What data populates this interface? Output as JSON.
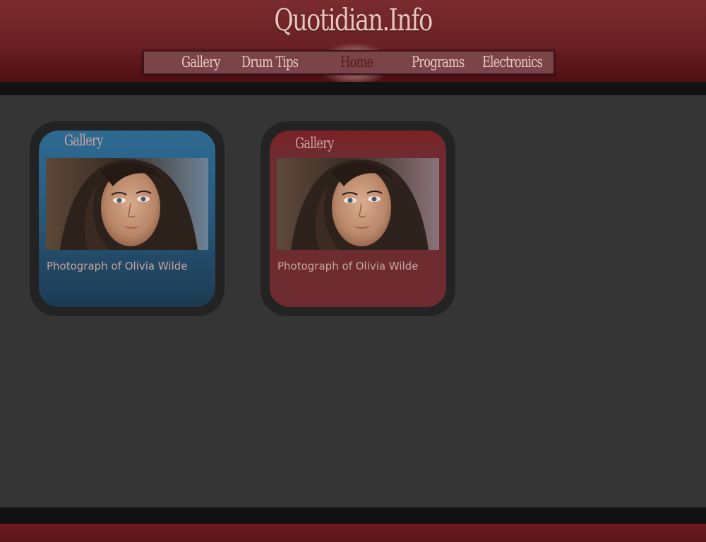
{
  "site": {
    "title": "Quotidian.Info"
  },
  "nav": {
    "items": [
      {
        "label": "Gallery"
      },
      {
        "label": "Drum Tips"
      },
      {
        "label": "Home",
        "active": true
      },
      {
        "label": "Programs"
      },
      {
        "label": "Electronics"
      }
    ]
  },
  "cards": [
    {
      "title": "Gallery",
      "caption": "Photograph of Olivia Wilde",
      "theme": "blue",
      "color": "#2a5d80"
    },
    {
      "title": "Gallery",
      "caption": "Photograph of Olivia Wilde",
      "theme": "red",
      "color": "#6e2c30"
    }
  ],
  "colors": {
    "header": "#6a2024",
    "background": "#353535",
    "band": "#121212",
    "nav_text": "#ecc9c4",
    "nav_active_text": "#5a1a1d",
    "caption_text": "#c8a4a0"
  }
}
